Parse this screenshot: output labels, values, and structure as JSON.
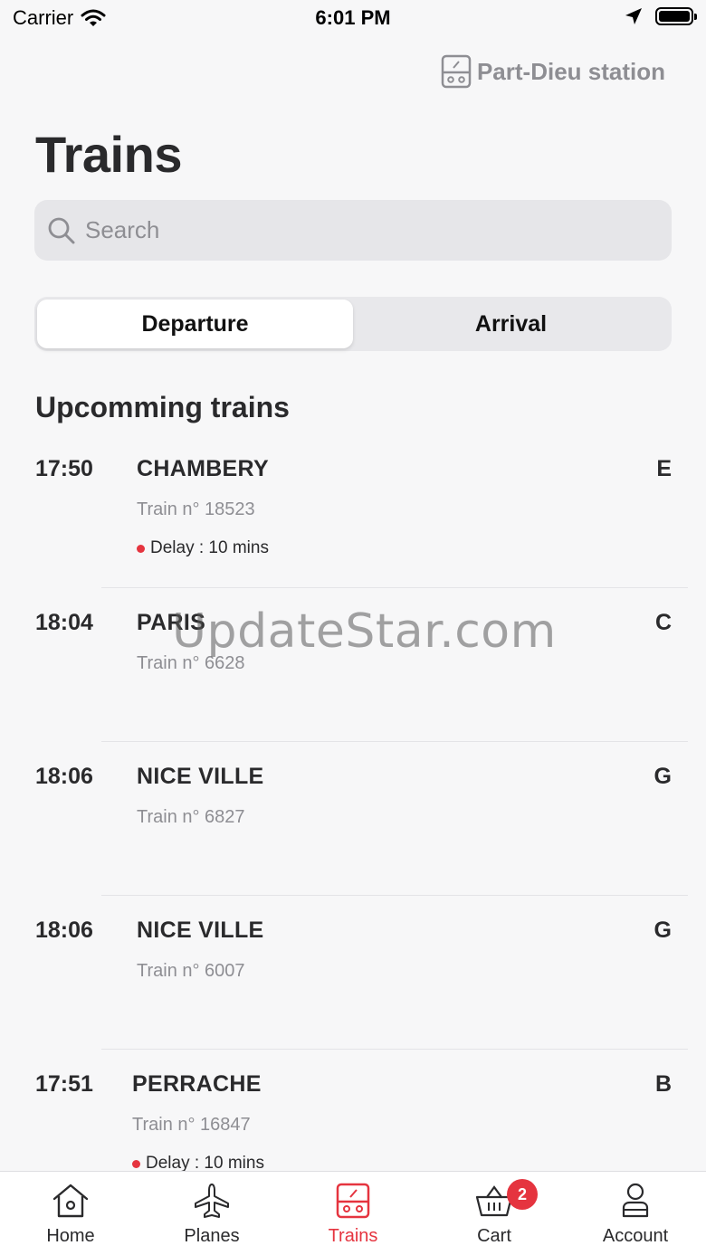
{
  "status_bar": {
    "carrier": "Carrier",
    "time": "6:01 PM"
  },
  "station": {
    "label": "Part-Dieu station"
  },
  "page_title": "Trains",
  "search": {
    "placeholder": "Search"
  },
  "segment": {
    "departure": "Departure",
    "arrival": "Arrival",
    "selected": "Departure"
  },
  "section_title": "Upcomming trains",
  "trains": [
    {
      "time": "17:50",
      "destination": "CHAMBERY",
      "number": "Train n° 18523",
      "delay": "Delay : 10 mins",
      "platform": "E"
    },
    {
      "time": "18:04",
      "destination": "PARIS",
      "number": "Train n° 6628",
      "delay": "",
      "platform": "C"
    },
    {
      "time": "18:06",
      "destination": "NICE VILLE",
      "number": "Train n° 6827",
      "delay": "",
      "platform": "G"
    },
    {
      "time": "18:06",
      "destination": "NICE VILLE",
      "number": "Train n° 6007",
      "delay": "",
      "platform": "G"
    },
    {
      "time": "17:51",
      "destination": "PERRACHE",
      "number": "Train n° 16847",
      "delay": "Delay : 10 mins",
      "platform": "B"
    }
  ],
  "watermark": "UpdateStar.com",
  "tab_bar": {
    "home": "Home",
    "planes": "Planes",
    "trains": "Trains",
    "cart": "Cart",
    "cart_badge": "2",
    "account": "Account",
    "active": "trains"
  },
  "colors": {
    "accent": "#e5343f",
    "muted": "#8e8e93",
    "text": "#2a2a2c",
    "background": "#f7f7f8"
  },
  "icons": [
    "wifi-icon",
    "location-arrow-icon",
    "battery-icon",
    "train-icon",
    "search-icon",
    "home-icon",
    "plane-icon",
    "cart-icon",
    "account-icon"
  ]
}
